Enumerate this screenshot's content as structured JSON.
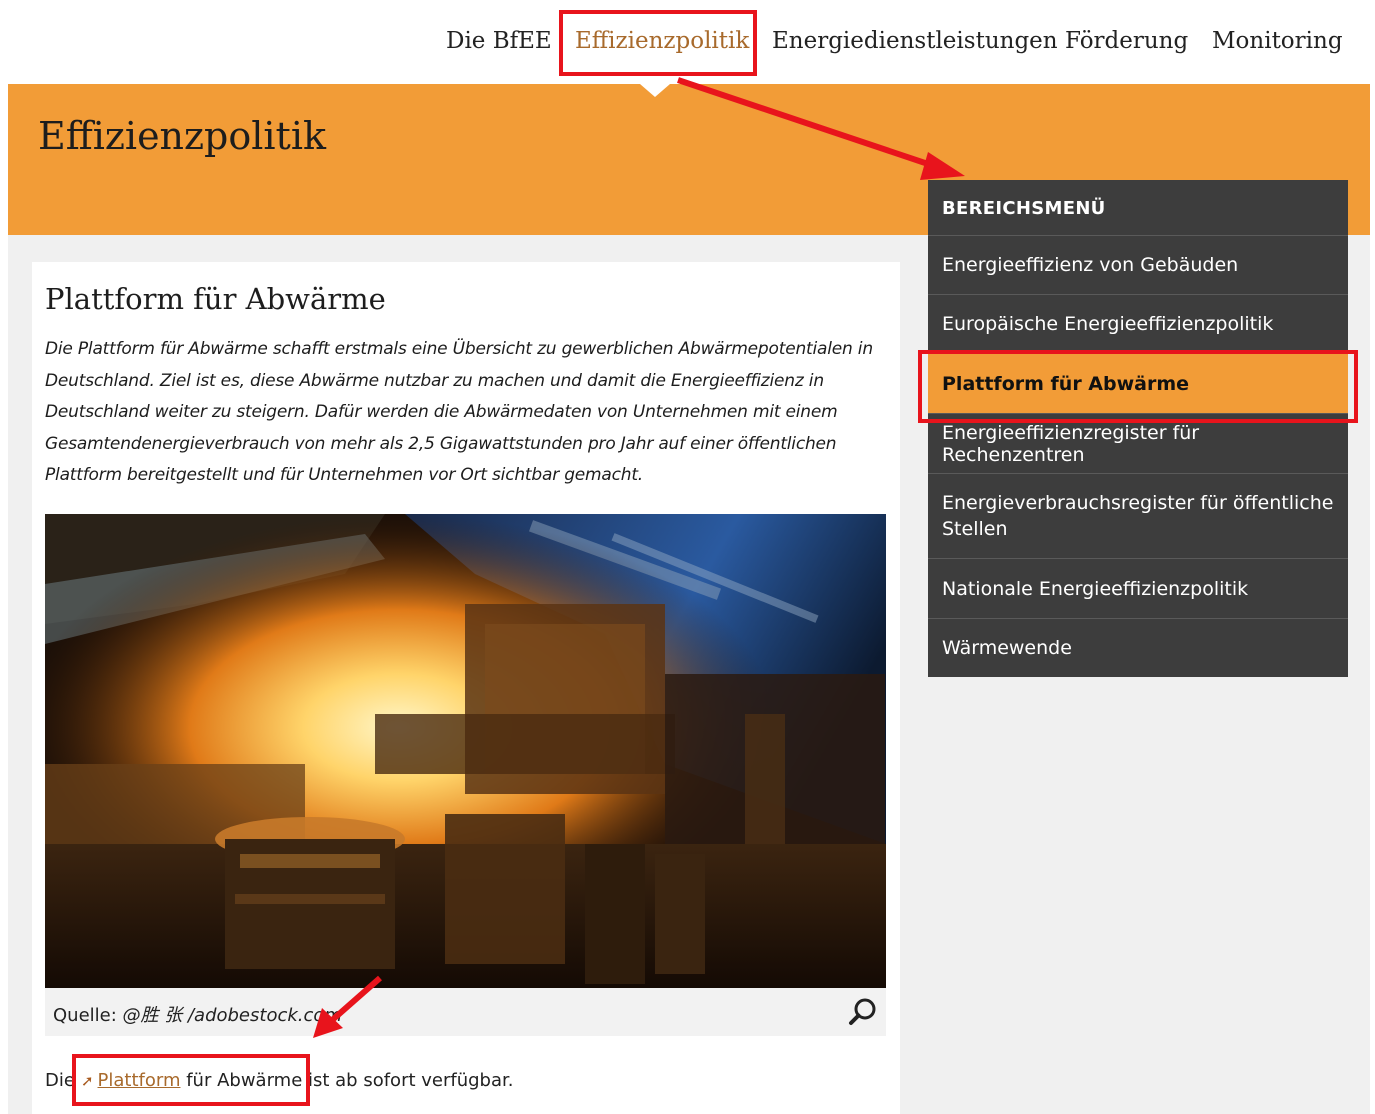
{
  "nav": {
    "items": [
      {
        "label": "Die BfEE",
        "active": false
      },
      {
        "label": "Effizienzpolitik",
        "active": true
      },
      {
        "label": "Energiedienstleistungen",
        "active": false
      },
      {
        "label": "Förderung",
        "active": false
      },
      {
        "label": "Monitoring",
        "active": false
      }
    ]
  },
  "banner": {
    "title": "Effizienzpolitik"
  },
  "article": {
    "title": "Plattform für Abwärme",
    "intro": "Die Plattform für Abwärme schafft erstmals eine Übersicht zu gewerblichen Abwärmepotentialen in Deutschland. Ziel ist es, diese Abwärme nutzbar zu machen und damit die Energieeffizienz in Deutschland weiter zu steigern. Dafür werden die Abwärmedaten von Unternehmen mit einem Gesamtendenergieverbrauch von mehr als 2,5 Gigawattstunden pro Jahr auf einer öffentlichen Plattform bereitgestellt und für Unternehmen vor Ort sichtbar gemacht.",
    "caption_label": "Quelle:",
    "caption_source": "@胜 张 /adobestock.com",
    "link_prefix": "Die",
    "link_text": "Plattform",
    "link_suffix": "für Abwärme ist ab sofort verfügbar."
  },
  "sidemenu": {
    "heading": "BEREICHSMENÜ",
    "items": [
      {
        "label": "Energieeffizienz von Gebäuden",
        "active": false
      },
      {
        "label": "Europäische Energieeffizienzpolitik",
        "active": false
      },
      {
        "label": "Plattform für Abwärme",
        "active": true
      },
      {
        "label": "Energieeffizienzregister für Rechenzentren",
        "active": false
      },
      {
        "label": "Energieverbrauchsregister für öffentliche Stellen",
        "active": false
      },
      {
        "label": "Nationale Energieeffizienzpolitik",
        "active": false
      },
      {
        "label": "Wärmewende",
        "active": false
      }
    ]
  },
  "colors": {
    "accent": "#f29c37",
    "link": "#a86a2c",
    "menu_bg": "#3d3d3d",
    "annotation": "#e8141c"
  },
  "icons": {
    "zoom": "magnifier-icon",
    "external_link": "external-arrow-icon"
  }
}
